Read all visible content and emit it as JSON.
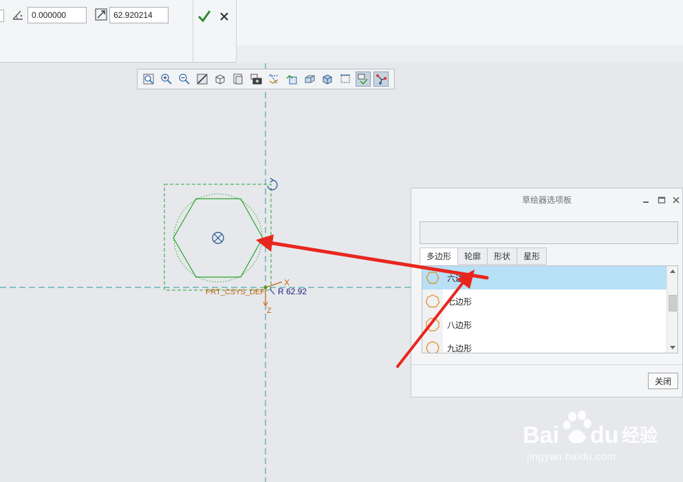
{
  "ribbon": {
    "angle_value": "0.000000",
    "scale_value": "62.920214"
  },
  "canvas": {
    "csys_label": "PRT_CSYS_DEF",
    "dimension_label": "R 62.92",
    "axis_z": "Z",
    "axis_x": "X"
  },
  "palette": {
    "title": "草绘器选项板",
    "tabs": [
      {
        "label": "多边形",
        "active": true
      },
      {
        "label": "轮廓",
        "active": false
      },
      {
        "label": "形状",
        "active": false
      },
      {
        "label": "星形",
        "active": false
      }
    ],
    "items": [
      {
        "label": "六边形",
        "selected": true
      },
      {
        "label": "七边形",
        "selected": false
      },
      {
        "label": "八边形",
        "selected": false
      },
      {
        "label": "九边形",
        "selected": false
      }
    ],
    "close_label": "关闭"
  },
  "colors": {
    "sketch_green": "#2aa52a",
    "selection_blue": "#b8e0f6",
    "annotation_red": "#e8261e",
    "centerline_teal": "#2a9a9a",
    "csys_orange": "#c0640c"
  },
  "watermark": {
    "logo": "Bai du 经验",
    "url": "jingyan.baidu.com"
  }
}
